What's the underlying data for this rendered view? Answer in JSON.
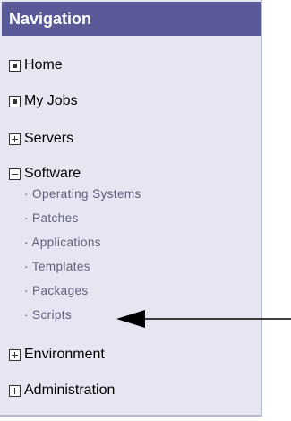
{
  "colors": {
    "header_bg": "#5a5a98",
    "panel_bg": "#e6e6f2"
  },
  "nav": {
    "title": "Navigation",
    "items": [
      {
        "label": "Home",
        "icon": "bullet-box-icon"
      },
      {
        "label": "My Jobs",
        "icon": "bullet-box-icon"
      },
      {
        "label": "Servers",
        "icon": "expand-plus-icon"
      },
      {
        "label": "Software",
        "icon": "collapse-minus-icon",
        "children": [
          "Operating Systems",
          "Patches",
          "Applications",
          "Templates",
          "Packages",
          "Scripts"
        ]
      },
      {
        "label": "Environment",
        "icon": "expand-plus-icon"
      },
      {
        "label": "Administration",
        "icon": "expand-plus-icon"
      }
    ]
  }
}
